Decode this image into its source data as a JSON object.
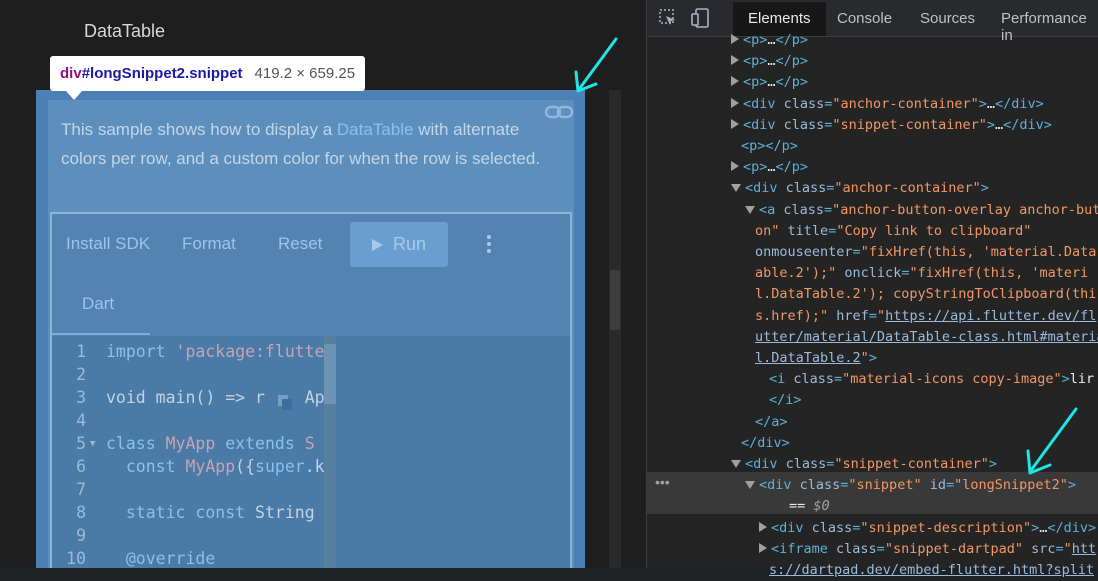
{
  "page": {
    "title": "DataTable",
    "description_pre": "This sample shows how to display a ",
    "description_link": "DataTable",
    "description_post": " with alternate colors per row, and a custom color for when the row is selected."
  },
  "tooltip": {
    "tag": "div",
    "selector": "#longSnippet2.snippet",
    "dimensions": "419.2 × 659.25"
  },
  "dartpad": {
    "toolbar": {
      "install_sdk": "Install SDK",
      "format": "Format",
      "reset": "Reset",
      "run": "Run"
    },
    "tab": "Dart",
    "code_lines": [
      {
        "n": "1",
        "fold": false,
        "parts": [
          [
            "kw",
            "import"
          ],
          [
            "pl",
            " "
          ],
          [
            "str",
            "'package:flutte"
          ]
        ]
      },
      {
        "n": "2",
        "fold": false,
        "parts": []
      },
      {
        "n": "3",
        "fold": false,
        "parts": [
          [
            "pl",
            "void main() => r"
          ],
          [
            "pl",
            "    "
          ],
          [
            "pl",
            "App"
          ]
        ]
      },
      {
        "n": "4",
        "fold": false,
        "parts": []
      },
      {
        "n": "5",
        "fold": true,
        "parts": [
          [
            "kw",
            "class"
          ],
          [
            "pl",
            " "
          ],
          [
            "cls",
            "MyApp"
          ],
          [
            "pl",
            " "
          ],
          [
            "kw",
            "extends"
          ],
          [
            "pl",
            " "
          ],
          [
            "cls",
            "S"
          ]
        ]
      },
      {
        "n": "6",
        "fold": false,
        "parts": [
          [
            "pl",
            "  "
          ],
          [
            "kw",
            "const"
          ],
          [
            "pl",
            " "
          ],
          [
            "cls",
            "MyApp"
          ],
          [
            "pl",
            "({"
          ],
          [
            "kw",
            "super"
          ],
          [
            "pl",
            ".k"
          ]
        ]
      },
      {
        "n": "7",
        "fold": false,
        "parts": []
      },
      {
        "n": "8",
        "fold": false,
        "parts": [
          [
            "pl",
            "  "
          ],
          [
            "kw",
            "static"
          ],
          [
            "pl",
            " "
          ],
          [
            "kw",
            "const"
          ],
          [
            "pl",
            " String "
          ]
        ]
      },
      {
        "n": "9",
        "fold": false,
        "parts": []
      },
      {
        "n": "10",
        "fold": false,
        "parts": [
          [
            "pl",
            "  "
          ],
          [
            "kw",
            "@override"
          ]
        ]
      }
    ]
  },
  "devtools": {
    "tabs": [
      "Elements",
      "Console",
      "Sources",
      "Performance in"
    ],
    "active_tab": "Elements",
    "dom_lines": [
      {
        "indent": 84,
        "arrow": "r",
        "html": [
          [
            "t",
            "<p>"
          ],
          [
            "ap",
            "…"
          ],
          [
            "t",
            "</p>"
          ]
        ]
      },
      {
        "indent": 84,
        "arrow": "r",
        "html": [
          [
            "t",
            "<p>"
          ],
          [
            "ap",
            "…"
          ],
          [
            "t",
            "</p>"
          ]
        ]
      },
      {
        "indent": 84,
        "arrow": "r",
        "html": [
          [
            "t",
            "<p>"
          ],
          [
            "ap",
            "…"
          ],
          [
            "t",
            "</p>"
          ]
        ]
      },
      {
        "indent": 84,
        "arrow": "r",
        "html": [
          [
            "t",
            "<div "
          ],
          [
            "an",
            "class"
          ],
          [
            "t",
            "="
          ],
          [
            "av",
            "\"anchor-container\""
          ],
          [
            "t",
            ">"
          ],
          [
            "ap",
            "…"
          ],
          [
            "t",
            "</div>"
          ]
        ]
      },
      {
        "indent": 84,
        "arrow": "r",
        "html": [
          [
            "t",
            "<div "
          ],
          [
            "an",
            "class"
          ],
          [
            "t",
            "="
          ],
          [
            "av",
            "\"snippet-container\""
          ],
          [
            "t",
            ">"
          ],
          [
            "ap",
            "…"
          ],
          [
            "t",
            "</div>"
          ]
        ]
      },
      {
        "indent": 94,
        "arrow": "",
        "html": [
          [
            "t",
            "<p></p>"
          ]
        ]
      },
      {
        "indent": 84,
        "arrow": "r",
        "html": [
          [
            "t",
            "<p>"
          ],
          [
            "ap",
            "…"
          ],
          [
            "t",
            "</p>"
          ]
        ]
      },
      {
        "indent": 84,
        "arrow": "d",
        "html": [
          [
            "t",
            "<div "
          ],
          [
            "an",
            "class"
          ],
          [
            "t",
            "="
          ],
          [
            "av",
            "\"anchor-container\""
          ],
          [
            "t",
            ">"
          ]
        ]
      },
      {
        "indent": 98,
        "arrow": "d",
        "html": [
          [
            "t",
            "<a "
          ],
          [
            "an",
            "class"
          ],
          [
            "t",
            "="
          ],
          [
            "av",
            "\"anchor-button-overlay anchor-but"
          ]
        ]
      },
      {
        "indent": 108,
        "arrow": "",
        "html": [
          [
            "av",
            "on\""
          ],
          [
            "ap",
            " "
          ],
          [
            "an",
            "title"
          ],
          [
            "t",
            "="
          ],
          [
            "av",
            "\"Copy link to clipboard\""
          ]
        ]
      },
      {
        "indent": 108,
        "arrow": "",
        "html": [
          [
            "an",
            "onmouseenter"
          ],
          [
            "t",
            "="
          ],
          [
            "av",
            "\"fixHref(this, 'material.Data"
          ]
        ]
      },
      {
        "indent": 108,
        "arrow": "",
        "html": [
          [
            "av",
            "able.2');\""
          ],
          [
            "ap",
            " "
          ],
          [
            "an",
            "onclick"
          ],
          [
            "t",
            "="
          ],
          [
            "av",
            "\"fixHref(this, 'materi"
          ]
        ]
      },
      {
        "indent": 108,
        "arrow": "",
        "html": [
          [
            "av",
            "l.DataTable.2'); copyStringToClipboard(thi"
          ]
        ]
      },
      {
        "indent": 108,
        "arrow": "",
        "html": [
          [
            "av",
            "s.href);\""
          ],
          [
            "ap",
            " "
          ],
          [
            "an",
            "href"
          ],
          [
            "t",
            "="
          ],
          [
            "av",
            "\""
          ],
          [
            "u",
            "https://api.flutter.dev/fl"
          ]
        ]
      },
      {
        "indent": 108,
        "arrow": "",
        "html": [
          [
            "u",
            "utter/material/DataTable-class.html#materia"
          ]
        ]
      },
      {
        "indent": 108,
        "arrow": "",
        "html": [
          [
            "u",
            "l.DataTable.2"
          ],
          [
            "av",
            "\""
          ],
          [
            "t",
            ">"
          ]
        ]
      },
      {
        "indent": 122,
        "arrow": "",
        "html": [
          [
            "t",
            "<i "
          ],
          [
            "an",
            "class"
          ],
          [
            "t",
            "="
          ],
          [
            "av",
            "\"material-icons copy-image\""
          ],
          [
            "t",
            ">"
          ],
          [
            "ap",
            "lir"
          ]
        ]
      },
      {
        "indent": 122,
        "arrow": "",
        "html": [
          [
            "t",
            "</i>"
          ]
        ]
      },
      {
        "indent": 108,
        "arrow": "",
        "html": [
          [
            "t",
            "</a>"
          ]
        ]
      },
      {
        "indent": 94,
        "arrow": "",
        "html": [
          [
            "t",
            "</div>"
          ]
        ]
      },
      {
        "indent": 84,
        "arrow": "d",
        "html": [
          [
            "t",
            "<div "
          ],
          [
            "an",
            "class"
          ],
          [
            "t",
            "="
          ],
          [
            "av",
            "\"snippet-container\""
          ],
          [
            "t",
            ">"
          ]
        ]
      },
      {
        "indent": 98,
        "arrow": "d",
        "html": [
          [
            "t",
            "<div "
          ],
          [
            "an",
            "class"
          ],
          [
            "t",
            "="
          ],
          [
            "av",
            "\"snippet\""
          ],
          [
            "ap",
            " "
          ],
          [
            "an",
            "id"
          ],
          [
            "t",
            "="
          ],
          [
            "av",
            "\"longSnippet2\""
          ],
          [
            "t",
            ">"
          ]
        ]
      },
      {
        "indent": 142,
        "arrow": "",
        "html": [
          [
            "ap",
            "== "
          ],
          [
            "dollar",
            "$0"
          ]
        ]
      },
      {
        "indent": 112,
        "arrow": "r",
        "html": [
          [
            "t",
            "<div "
          ],
          [
            "an",
            "class"
          ],
          [
            "t",
            "="
          ],
          [
            "av",
            "\"snippet-description\""
          ],
          [
            "t",
            ">"
          ],
          [
            "ap",
            "…"
          ],
          [
            "t",
            "</div>"
          ]
        ]
      },
      {
        "indent": 112,
        "arrow": "r",
        "html": [
          [
            "t",
            "<iframe "
          ],
          [
            "an",
            "class"
          ],
          [
            "t",
            "="
          ],
          [
            "av",
            "\"snippet-dartpad\""
          ],
          [
            "ap",
            " "
          ],
          [
            "an",
            "src"
          ],
          [
            "t",
            "="
          ],
          [
            "av",
            "\""
          ],
          [
            "u",
            "htt"
          ]
        ]
      },
      {
        "indent": 122,
        "arrow": "",
        "html": [
          [
            "u",
            "s://dartpad.dev/embed-flutter.html?split"
          ]
        ]
      }
    ],
    "selected_dots": "•••"
  },
  "colors": {
    "highlight": "#4a80b3",
    "annotation_arrow": "#1ee6e6"
  }
}
